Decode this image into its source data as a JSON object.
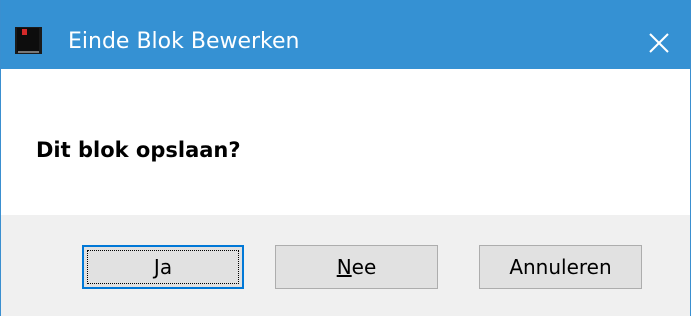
{
  "window": {
    "title": "Einde Blok Bewerken",
    "app_icon": "book-icon",
    "close_icon": "close-icon",
    "titlebar_color": "#3591d3"
  },
  "message": "Dit blok opslaan?",
  "buttons": {
    "ja": {
      "mnemonic": "J",
      "rest": "a"
    },
    "nee": {
      "mnemonic": "N",
      "rest": "ee"
    },
    "annuleren": {
      "label": "Annuleren"
    }
  }
}
